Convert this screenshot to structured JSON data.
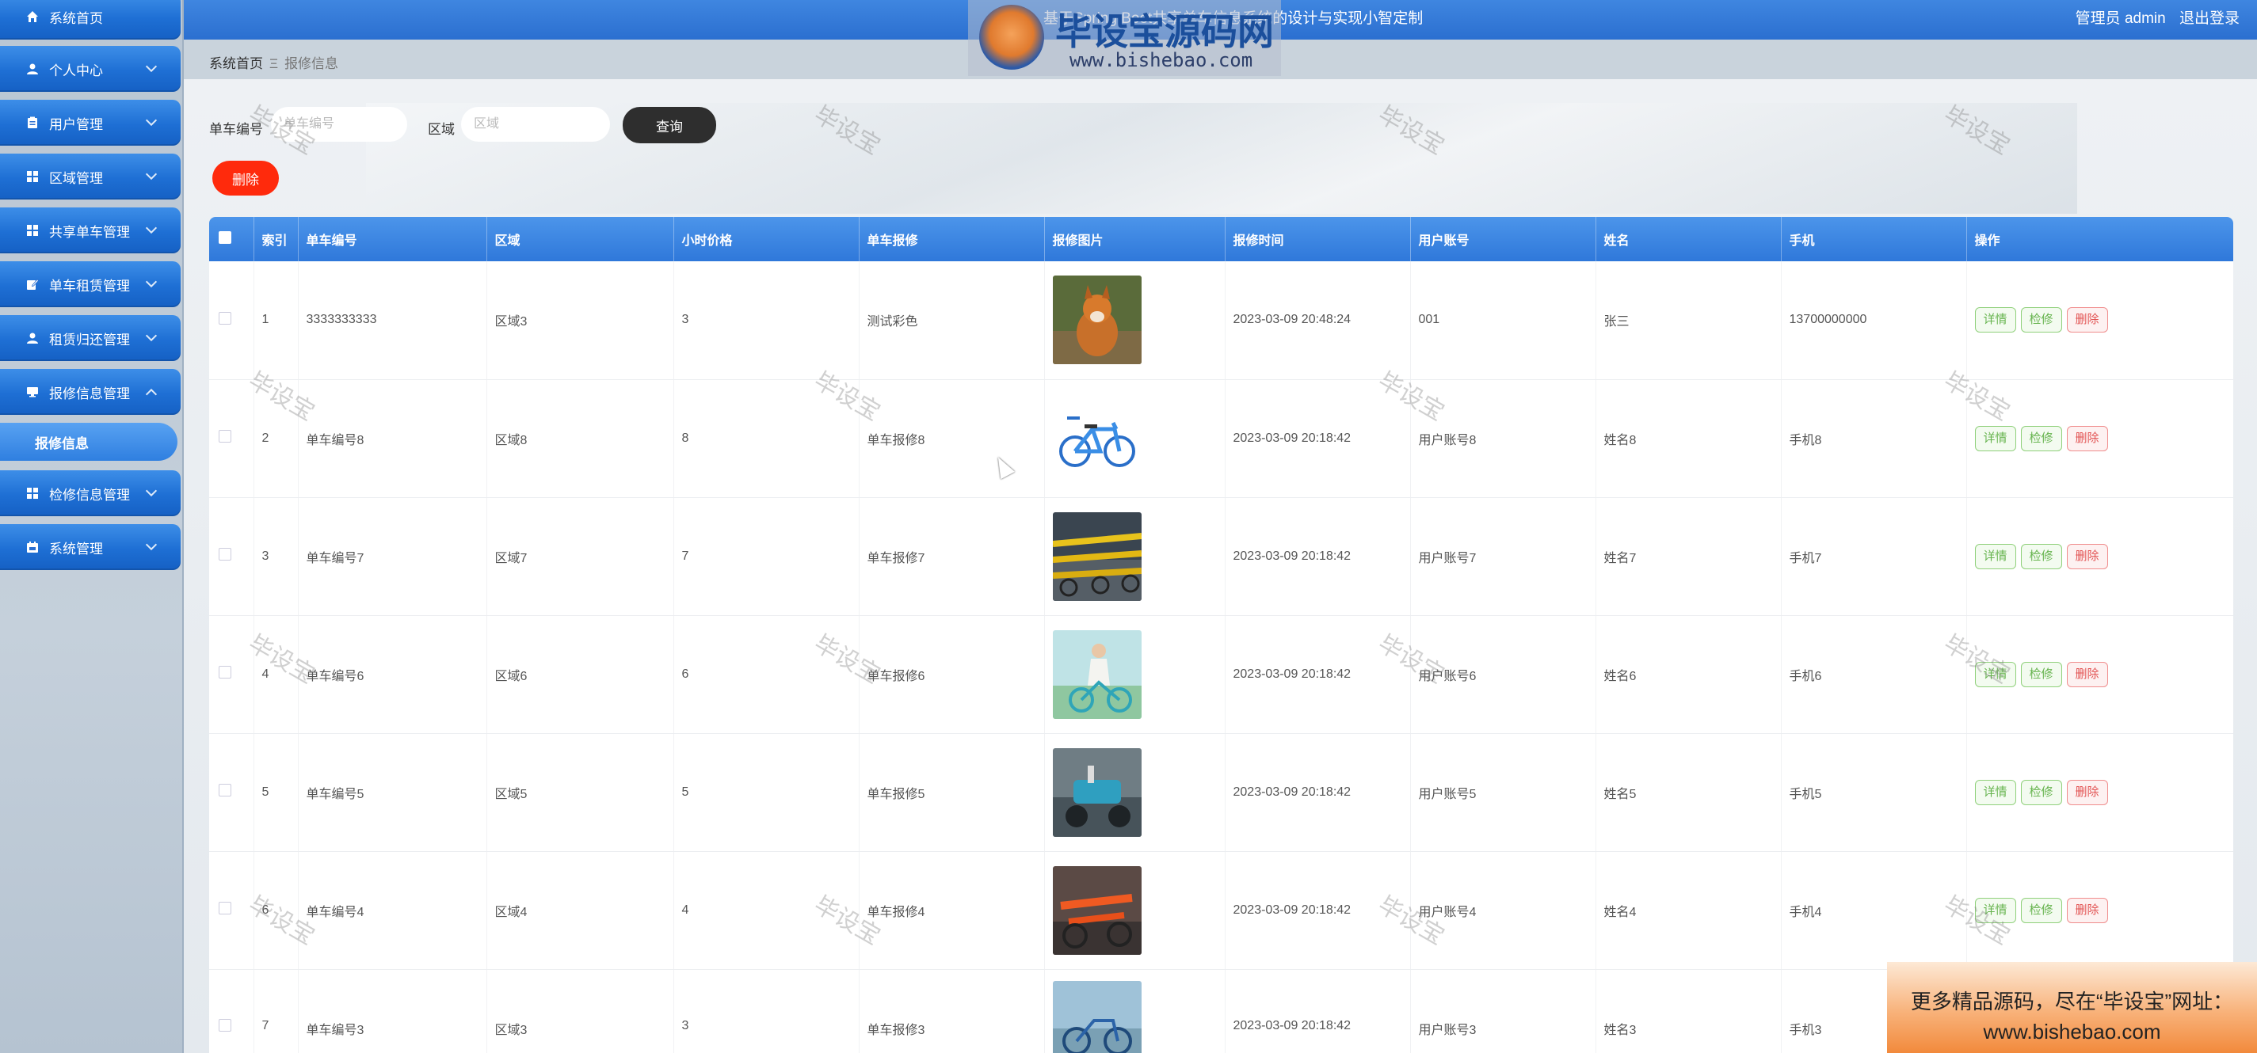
{
  "header": {
    "title": "基于Spring Boot共享单车信息系统的设计与实现小智定制",
    "user": "管理员 admin",
    "logout": "退出登录"
  },
  "sidebar": {
    "items": [
      {
        "label": "系统首页",
        "icon": "home-icon"
      },
      {
        "label": "个人中心",
        "icon": "user-icon"
      },
      {
        "label": "用户管理",
        "icon": "clipboard-icon"
      },
      {
        "label": "区域管理",
        "icon": "grid-icon"
      },
      {
        "label": "共享单车管理",
        "icon": "grid-icon"
      },
      {
        "label": "单车租赁管理",
        "icon": "edit-icon"
      },
      {
        "label": "租赁归还管理",
        "icon": "user-icon"
      },
      {
        "label": "报修信息管理",
        "icon": "monitor-icon"
      },
      {
        "label": "检修信息管理",
        "icon": "grid-icon"
      },
      {
        "label": "系统管理",
        "icon": "calendar-icon"
      }
    ],
    "sub_item": "报修信息"
  },
  "breadcrumb": {
    "home": "系统首页",
    "separator": "Ξ",
    "current": "报修信息"
  },
  "search": {
    "bike_no_label": "单车编号",
    "bike_no_placeholder": "单车编号",
    "area_label": "区域",
    "area_placeholder": "区域",
    "query_button": "查询",
    "delete_button": "删除"
  },
  "table": {
    "columns": [
      "索引",
      "单车编号",
      "区域",
      "小时价格",
      "单车报修",
      "报修图片",
      "报修时间",
      "用户账号",
      "姓名",
      "手机",
      "操作"
    ],
    "actions": {
      "detail": "详情",
      "check": "检修",
      "delete": "删除"
    },
    "rows": [
      {
        "index": "1",
        "bike_no": "3333333333",
        "area": "区域3",
        "price": "3",
        "repair": "测试彩色",
        "image": "fox-photo",
        "time": "2023-03-09 20:48:24",
        "account": "001",
        "name": "张三",
        "phone": "13700000000"
      },
      {
        "index": "2",
        "bike_no": "单车编号8",
        "area": "区域8",
        "price": "8",
        "repair": "单车报修8",
        "image": "blue-bike-photo",
        "time": "2023-03-09 20:18:42",
        "account": "用户账号8",
        "name": "姓名8",
        "phone": "手机8"
      },
      {
        "index": "3",
        "bike_no": "单车编号7",
        "area": "区域7",
        "price": "7",
        "repair": "单车报修7",
        "image": "bike-row-photo",
        "time": "2023-03-09 20:18:42",
        "account": "用户账号7",
        "name": "姓名7",
        "phone": "手机7"
      },
      {
        "index": "4",
        "bike_no": "单车编号6",
        "area": "区域6",
        "price": "6",
        "repair": "单车报修6",
        "image": "rider-photo",
        "time": "2023-03-09 20:18:42",
        "account": "用户账号6",
        "name": "姓名6",
        "phone": "手机6"
      },
      {
        "index": "5",
        "bike_no": "单车编号5",
        "area": "区域5",
        "price": "5",
        "repair": "单车报修5",
        "image": "ebike-photo",
        "time": "2023-03-09 20:18:42",
        "account": "用户账号5",
        "name": "姓名5",
        "phone": "手机5"
      },
      {
        "index": "6",
        "bike_no": "单车编号4",
        "area": "区域4",
        "price": "4",
        "repair": "单车报修4",
        "image": "orange-bike-photo",
        "time": "2023-03-09 20:18:42",
        "account": "用户账号4",
        "name": "姓名4",
        "phone": "手机4"
      },
      {
        "index": "7",
        "bike_no": "单车编号3",
        "area": "区域3",
        "price": "3",
        "repair": "单车报修3",
        "image": "street-bike-photo",
        "time": "2023-03-09 20:18:42",
        "account": "用户账号3",
        "name": "姓名3",
        "phone": "手机3"
      }
    ]
  },
  "watermark": {
    "text": "毕设宝",
    "logo_text": "毕设宝源码网",
    "logo_url": "www.bishebao.com"
  },
  "promo": {
    "line1": "更多精品源码，尽在“毕设宝”网址：",
    "line2": "www.bishebao.com"
  },
  "colors": {
    "primary": "#2b6fd0",
    "danger": "#ff2a0c",
    "query": "#2e2e2e"
  }
}
